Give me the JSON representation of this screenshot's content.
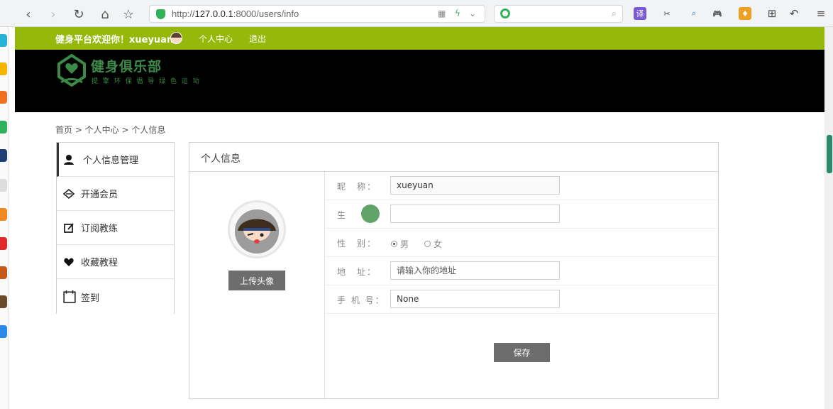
{
  "browser": {
    "url_prefix": "http://",
    "url_host": "127.0.0.1",
    "url_rest": ":8000/users/info",
    "extension_labels": [
      "译",
      "✂",
      "⌕",
      "🎮",
      "♦"
    ]
  },
  "site": {
    "welcome": "健身平台欢迎你！xueyuan",
    "top_links": [
      "个人中心",
      "退出"
    ],
    "logo_title": "健身俱乐部",
    "logo_sub": "提 擎 环 保  倡 导 绿 色 运 动",
    "breadcrumb": "首页 > 个人中心 > 个人信息",
    "menu": [
      {
        "label": "个人信息管理",
        "icon": "user-icon"
      },
      {
        "label": "开通会员",
        "icon": "gem-icon"
      },
      {
        "label": "订阅教练",
        "icon": "edit-icon"
      },
      {
        "label": "收藏教程",
        "icon": "heart-icon"
      },
      {
        "label": "签到",
        "icon": "calendar-icon"
      }
    ],
    "panel_title": "个人信息",
    "upload_label": "上传头像",
    "form": {
      "nickname_label": "昵　称：",
      "nickname_value": "xueyuan",
      "birthday_label": "生",
      "gender_label": "性　别：",
      "gender_male": "男",
      "gender_female": "女",
      "address_label": "地　址：",
      "address_placeholder": "请输入你的地址",
      "phone_label": "手 机 号：",
      "phone_value": "None",
      "save_label": "保存"
    }
  },
  "colors": {
    "topbar": "#95b80b",
    "banner": "#000000",
    "brand_green": "#3b8a47",
    "button_gray": "#6d6d6d"
  }
}
